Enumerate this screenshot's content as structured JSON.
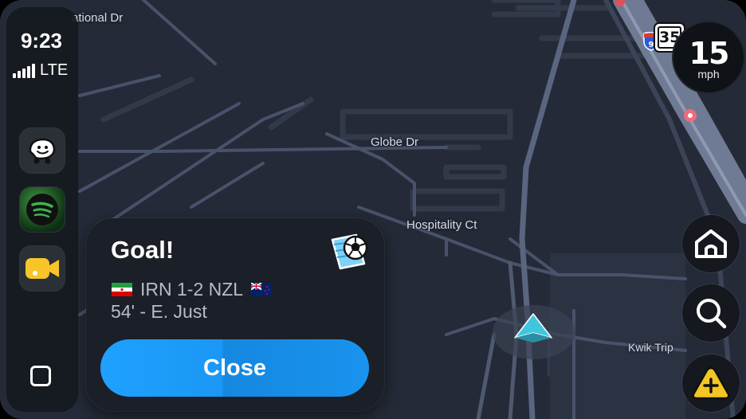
{
  "status": {
    "time": "9:23",
    "network": "LTE"
  },
  "dock": {
    "apps": [
      {
        "name": "Waze",
        "icon": "waze-icon"
      },
      {
        "name": "Spotify",
        "icon": "spotify-icon"
      },
      {
        "name": "Video",
        "icon": "video-camera-icon"
      }
    ],
    "home_icon": "square-icon"
  },
  "map": {
    "labels": {
      "national_dr": "ational Dr",
      "globe_dr": "Globe Dr",
      "hospitality_ct": "Hospitality Ct",
      "kwik_trip": "Kwik Trip"
    },
    "interstate_shield": "9",
    "speed_limit": "35"
  },
  "notification": {
    "title": "Goal!",
    "icon": "soccer-ball-icon",
    "home_team": "IRN",
    "score": "1-2",
    "away_team": "NZL",
    "score_line": "IRN 1-2 NZL",
    "scorer": "54' - E. Just",
    "close_label": "Close"
  },
  "speedometer": {
    "speed": "15",
    "unit": "mph"
  },
  "colors": {
    "map_background": "#242a37",
    "road": "#4a5366",
    "accent_blue": "#1fa1ff",
    "vehicle_arrow": "#3fc6dc",
    "report_yellow": "#f3c623"
  },
  "controls": [
    "home-icon",
    "search-icon",
    "report-hazard-icon"
  ]
}
